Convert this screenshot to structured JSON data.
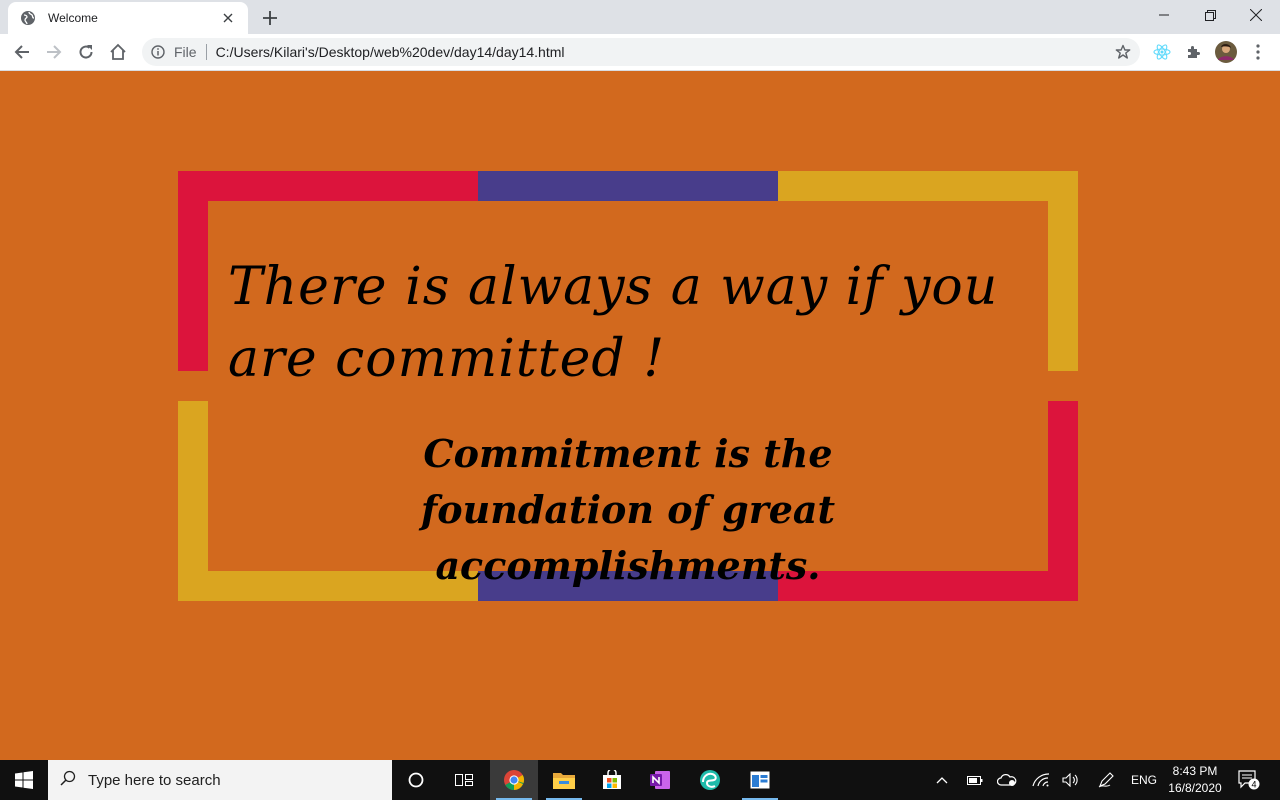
{
  "browser": {
    "tab_title": "Welcome",
    "url_scheme_label": "File",
    "url": "C:/Users/Kilari's/Desktop/web%20dev/day14/day14.html",
    "icons": [
      "globe-icon",
      "close-icon",
      "plus-icon",
      "minimize-icon",
      "restore-icon",
      "back-icon",
      "forward-icon",
      "reload-icon",
      "home-icon",
      "info-icon",
      "star-icon",
      "react-icon",
      "puzzle-icon",
      "avatar",
      "kebab-menu-icon"
    ]
  },
  "page": {
    "background": "#D2691E",
    "headline": "There is always a way if you are committed !",
    "subtext": "Commitment is the foundation of great accomplishments.",
    "frame_colors": {
      "red": "#DC143C",
      "purple": "#483D8B",
      "gold": "#DAA520"
    }
  },
  "taskbar": {
    "search_placeholder": "Type here to search",
    "language": "ENG",
    "time": "8:43 PM",
    "date": "16/8/2020",
    "notification_count": "4",
    "apps": [
      "cortana-icon",
      "task-view-icon",
      "chrome-icon",
      "file-explorer-icon",
      "store-icon",
      "onenote-icon",
      "edge-icon",
      "app-window-icon"
    ]
  }
}
